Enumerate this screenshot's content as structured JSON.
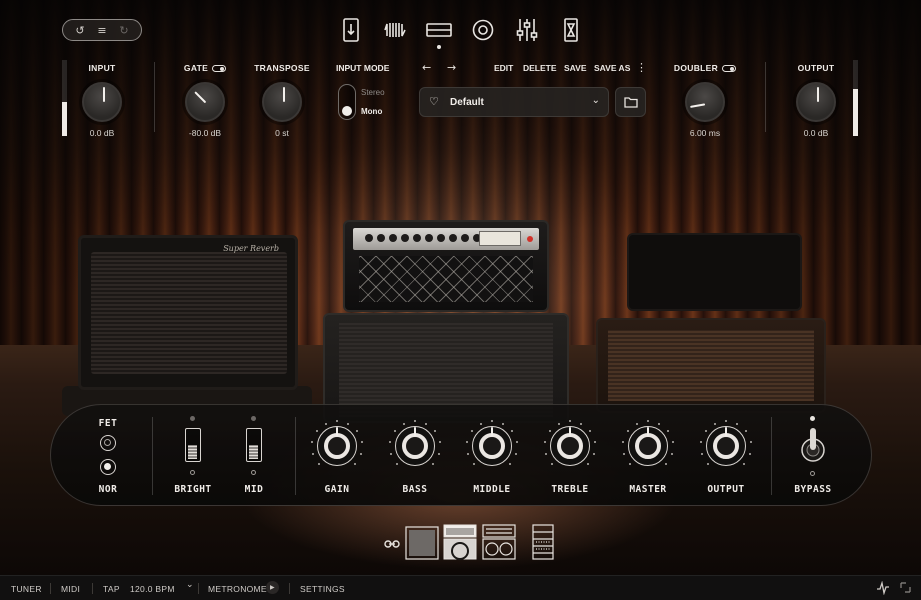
{
  "toolbar": {
    "undo_icon": "undo-icon",
    "menu_icon": "menu-icon",
    "redo_icon": "redo-icon",
    "undo_glyph": "↺",
    "menu_glyph": "≡",
    "redo_glyph": "↻"
  },
  "nav": {
    "items": [
      "tuner-view-icon",
      "pedal-view-icon",
      "amp-view-icon",
      "cabinet-view-icon",
      "eq-mixer-icon",
      "rack-fx-icon"
    ],
    "active": "amp-view-icon"
  },
  "header": {
    "input": {
      "label": "INPUT",
      "value": "0.0",
      "unit": "dB"
    },
    "gate": {
      "label": "GATE",
      "value": "-80.0",
      "unit": "dB",
      "enabled": true
    },
    "transpose": {
      "label": "TRANSPOSE",
      "value": "0",
      "unit": "st"
    },
    "input_mode": {
      "label": "INPUT MODE",
      "options": [
        "Stereo",
        "Mono"
      ],
      "selected": "Mono"
    },
    "doubler": {
      "label": "DOUBLER",
      "value": "6.00",
      "unit": "ms",
      "enabled": true
    },
    "output": {
      "label": "OUTPUT",
      "value": "0.0",
      "unit": "dB"
    },
    "input_meter_level": 0.45,
    "output_meter_level": 0.62
  },
  "preset": {
    "back_glyph": "←",
    "forward_glyph": "→",
    "edit": "EDIT",
    "delete": "DELETE",
    "save": "SAVE",
    "save_as": "SAVE AS",
    "more_glyph": "⋮",
    "heart_glyph": "♡",
    "name": "Default",
    "chevron_glyph": "⌄"
  },
  "amp_panel": {
    "fet_label": "FET",
    "nor_label": "NOR",
    "bright_label": "BRIGHT",
    "mid_label": "MID",
    "knobs": [
      "GAIN",
      "BASS",
      "MIDDLE",
      "TREBLE",
      "MASTER",
      "OUTPUT"
    ],
    "bypass_label": "BYPASS"
  },
  "amp_art": {
    "badge": "Super Reverb"
  },
  "bottom_bar": {
    "tuner": "TUNER",
    "midi": "MIDI",
    "tap": "TAP",
    "tempo": "120.0 BPM",
    "tempo_chevron": "⌄",
    "metronome": "METRONOME",
    "play_glyph": "▶",
    "settings": "SETTINGS"
  },
  "colors": {
    "accent": "#f0ece8",
    "panel": "#121110",
    "curtain": "#6b3418"
  }
}
